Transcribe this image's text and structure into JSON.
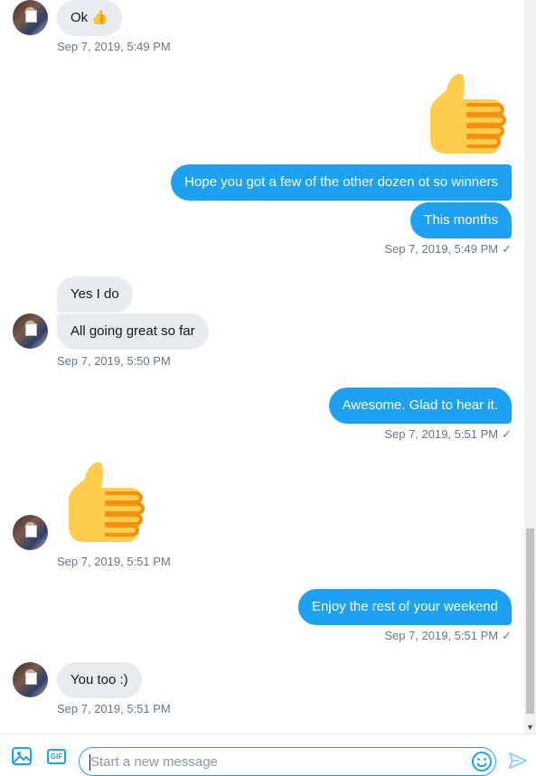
{
  "messages": [
    {
      "text": "Ok",
      "emoji": "👍",
      "time": "Sep 7, 2019, 5:49 PM"
    },
    {
      "out_lines": [
        "Hope you got a few of the other dozen ot so winners",
        "This months"
      ],
      "time": "Sep 7, 2019, 5:49 PM",
      "check": "✓"
    },
    {
      "in_lines": [
        "Yes I do",
        "All going great so far"
      ],
      "time": "Sep 7, 2019, 5:50 PM"
    },
    {
      "text": "Awesome.  Glad to hear it.",
      "time": "Sep 7, 2019, 5:51 PM",
      "check": "✓"
    },
    {
      "time": "Sep 7, 2019, 5:51 PM"
    },
    {
      "text": "Enjoy the rest of your weekend",
      "time": "Sep 7, 2019, 5:51 PM",
      "check": "✓"
    },
    {
      "text": "You too :)",
      "time": "Sep 7, 2019, 5:51 PM"
    }
  ],
  "composer": {
    "placeholder": "Start a new message",
    "icons": [
      "image-icon",
      "gif-icon",
      "emoji-icon",
      "send-icon"
    ],
    "gif_label": "GIF"
  },
  "colors": {
    "accent": "#1da1f2",
    "incoming_bg": "#e6ecf0",
    "meta_text": "#657786"
  }
}
